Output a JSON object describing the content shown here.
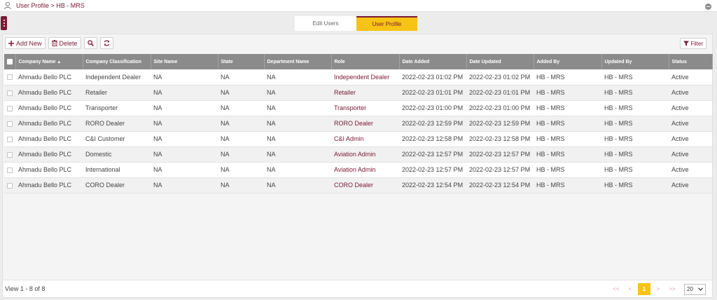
{
  "header": {
    "breadcrumb": "User Profile > HB - MRS",
    "breadcrumb_icon": "user-profile-icon",
    "collapse_icon": "minus-circle-icon"
  },
  "tabs": [
    {
      "label": "Edit Users",
      "active": false
    },
    {
      "label": "User Profile",
      "active": true
    }
  ],
  "toolbar": {
    "add_label": "Add New",
    "delete_label": "Delete",
    "search_icon": "search-icon",
    "refresh_icon": "refresh-icon",
    "filter_label": "Filter"
  },
  "table": {
    "columns": [
      "Company Name",
      "Company Classification",
      "Site Name",
      "State",
      "Department Name",
      "Role",
      "Date Added",
      "Date Updated",
      "Added By",
      "Updated By",
      "Status"
    ],
    "rows": [
      [
        "Ahmadu Bello PLC",
        "Independent Dealer",
        "NA",
        "NA",
        "NA",
        "Independent Dealer",
        "2022-02-23 01:02 PM",
        "2022-02-23 01:02 PM",
        "HB - MRS",
        "HB - MRS",
        "Active"
      ],
      [
        "Ahmadu Bello PLC",
        "Retailer",
        "NA",
        "NA",
        "NA",
        "Retailer",
        "2022-02-23 01:01 PM",
        "2022-02-23 01:01 PM",
        "HB - MRS",
        "HB - MRS",
        "Active"
      ],
      [
        "Ahmadu Bello PLC",
        "Transporter",
        "NA",
        "NA",
        "NA",
        "Transporter",
        "2022-02-23 01:00 PM",
        "2022-02-23 01:00 PM",
        "HB - MRS",
        "HB - MRS",
        "Active"
      ],
      [
        "Ahmadu Bello PLC",
        "RORO Dealer",
        "NA",
        "NA",
        "NA",
        "RORO Dealer",
        "2022-02-23 12:59 PM",
        "2022-02-23 12:59 PM",
        "HB - MRS",
        "HB - MRS",
        "Active"
      ],
      [
        "Ahmadu Bello PLC",
        "C&I Customer",
        "NA",
        "NA",
        "NA",
        "C&I Admin",
        "2022-02-23 12:58 PM",
        "2022-02-23 12:58 PM",
        "HB - MRS",
        "HB - MRS",
        "Active"
      ],
      [
        "Ahmadu Bello PLC",
        "Domestic",
        "NA",
        "NA",
        "NA",
        "Aviation Admin",
        "2022-02-23 12:57 PM",
        "2022-02-23 12:57 PM",
        "HB - MRS",
        "HB - MRS",
        "Active"
      ],
      [
        "Ahmadu Bello PLC",
        "International",
        "NA",
        "NA",
        "NA",
        "Aviation Admin",
        "2022-02-23 12:57 PM",
        "2022-02-23 12:57 PM",
        "HB - MRS",
        "HB - MRS",
        "Active"
      ],
      [
        "Ahmadu Bello PLC",
        "CORO Dealer",
        "NA",
        "NA",
        "NA",
        "CORO Dealer",
        "2022-02-23 12:54 PM",
        "2022-02-23 12:54 PM",
        "HB - MRS",
        "HB - MRS",
        "Active"
      ]
    ]
  },
  "footer": {
    "view_info": "View 1 - 8 of 8",
    "pager": {
      "first": "<<",
      "prev": "<",
      "current_page": "1",
      "next": ">",
      "last": ">>"
    },
    "page_size": "20"
  },
  "colors": {
    "accent": "#7a1a34",
    "highlight": "#f7c315",
    "header_bg": "#8b8b8b"
  }
}
